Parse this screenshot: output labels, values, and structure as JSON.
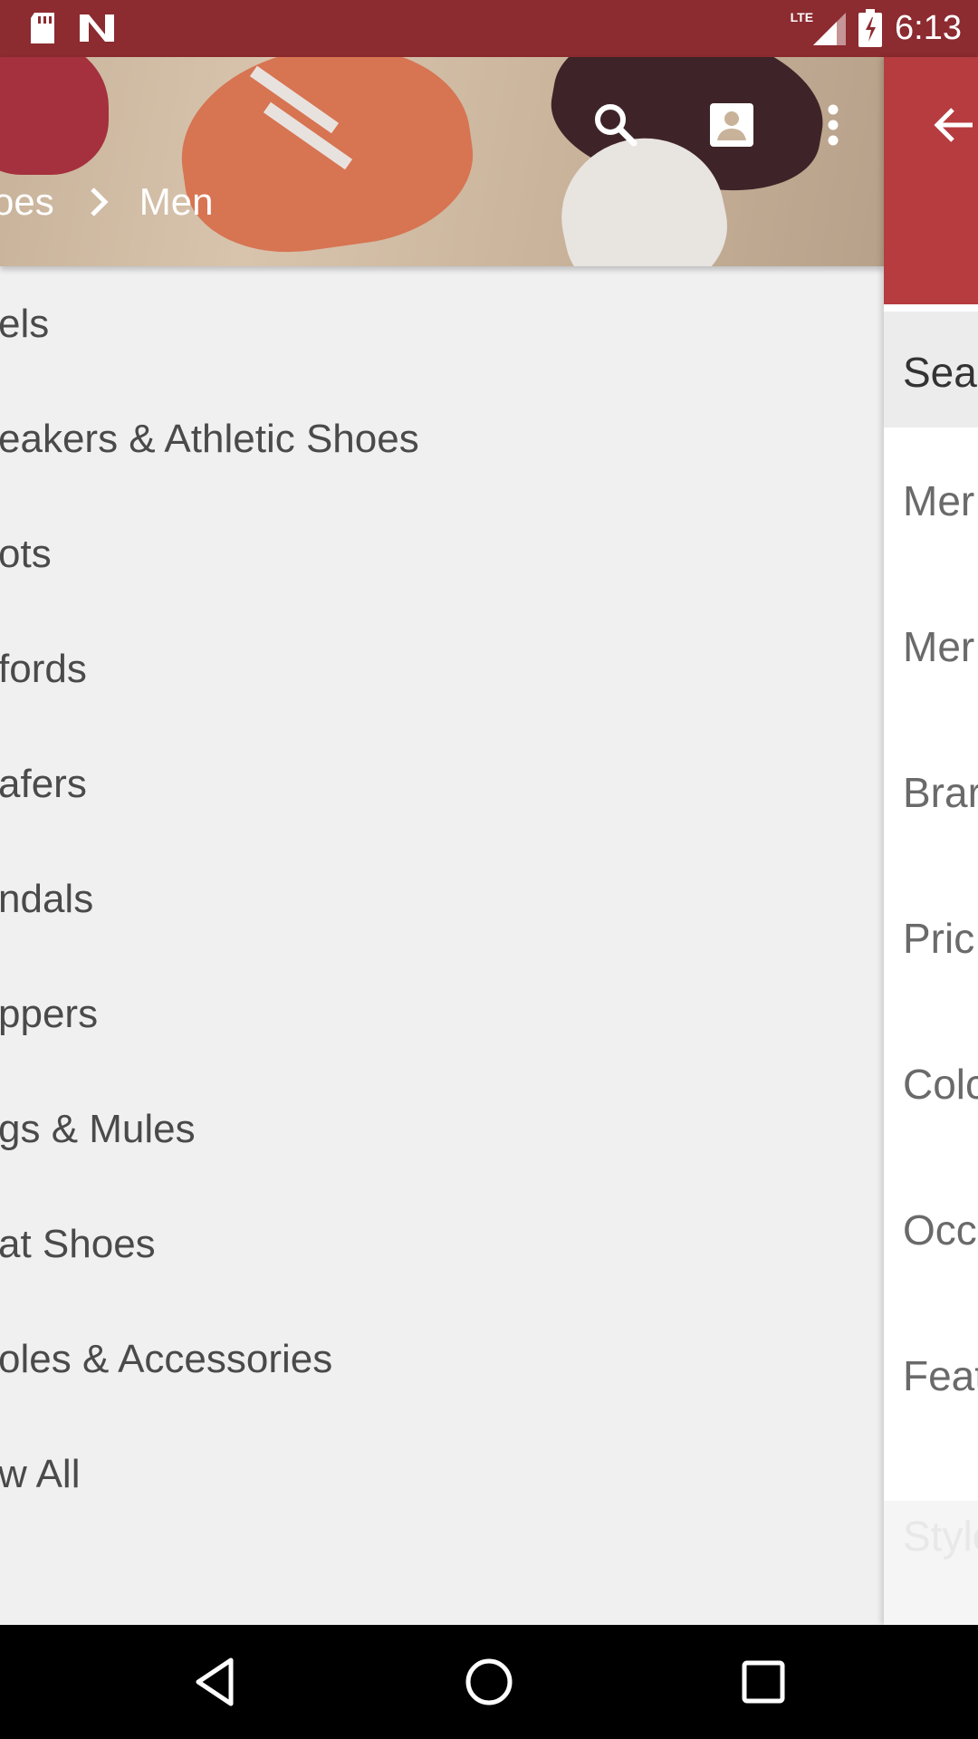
{
  "status_bar": {
    "time": "6:13",
    "network": "LTE"
  },
  "header": {
    "breadcrumb_prev": "oes",
    "breadcrumb_current": "Men"
  },
  "categories": [
    "els",
    "eakers & Athletic Shoes",
    "ots",
    "fords",
    "afers",
    "ndals",
    "ppers",
    "gs & Mules",
    "at Shoes",
    "oles & Accessories",
    "w All"
  ],
  "drawer": {
    "search_label": "Sear",
    "items": [
      "Mer",
      "Mer",
      "Brar",
      "Pric",
      "Colc",
      "Occ",
      "Feat"
    ],
    "footer_label": "Style"
  },
  "colors": {
    "status_bar": "#8c2b30",
    "drawer_header": "#b63c40",
    "list_bg": "#f0f0f0"
  },
  "icons": [
    "sd-card-icon",
    "notification-n-icon",
    "signal-icon",
    "battery-charging-icon",
    "search-icon",
    "account-box-icon",
    "more-vert-icon",
    "back-arrow-icon",
    "nav-back-icon",
    "nav-home-icon",
    "nav-recents-icon"
  ]
}
